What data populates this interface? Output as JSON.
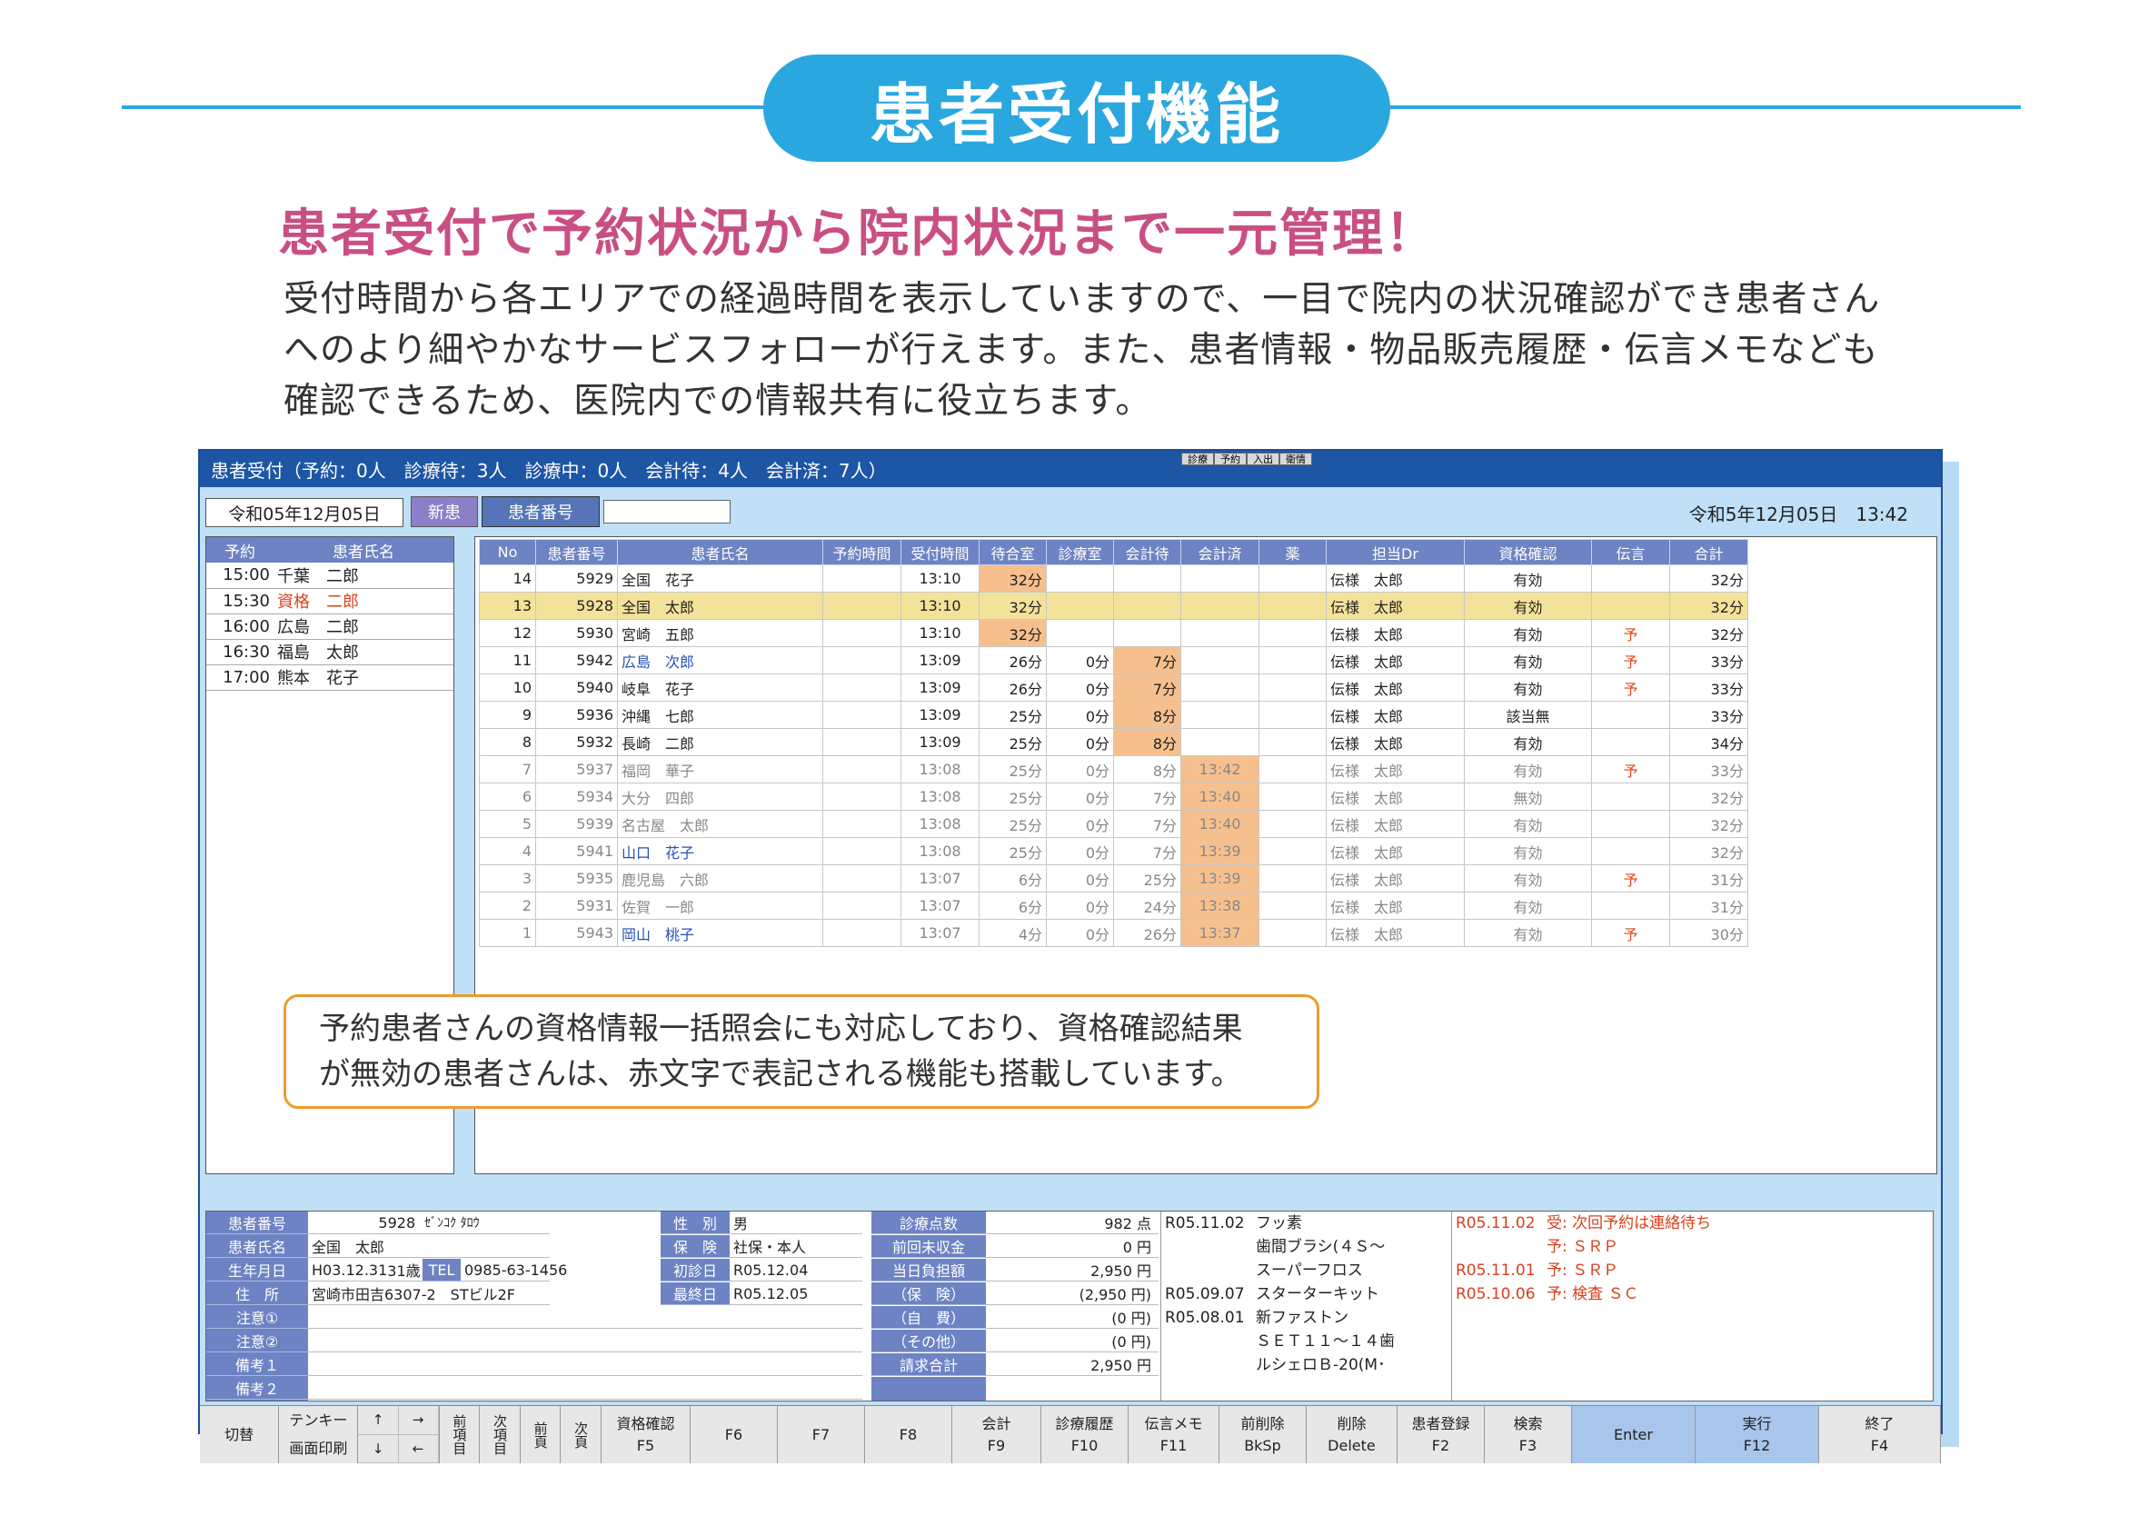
{
  "page": {
    "title": "患者受付機能",
    "headline": "患者受付で予約状況から院内状況まで一元管理！",
    "description": [
      "受付時間から各エリアでの経過時間を表示していますので、一目で院内の状況確認ができ患者さん",
      "へのより細やかなサービスフォローが行えます。また、患者情報・物品販売履歴・伝言メモなども",
      "確認できるため、医院内での情報共有に役立ちます。"
    ],
    "callout": [
      "予約患者さんの資格情報一括照会にも対応しており、資格確認結果",
      "が無効の患者さんは、赤文字で表記される機能も搭載しています。"
    ],
    "accent_color": "#2aa7df",
    "headline_color": "#c94f83"
  },
  "app": {
    "titlebar": "患者受付（予約：0人　診療待：3人　診療中：0人　会計待：4人　会計済：7人）",
    "mini_tabs": [
      "診療",
      "予約",
      "入出",
      "衛情"
    ],
    "date": "令和05年12月05日",
    "new_button": "新患",
    "pid_label": "患者番号",
    "pid_value": "",
    "now": "令和5年12月05日　13:42",
    "left_headers": [
      "予約",
      "患者氏名"
    ],
    "appointments": [
      {
        "time": "15:00",
        "name": "千葉　二郎",
        "red": false
      },
      {
        "time": "15:30",
        "name": "資格　二郎",
        "red": true
      },
      {
        "time": "16:00",
        "name": "広島　二郎",
        "red": false
      },
      {
        "time": "16:30",
        "name": "福島　太郎",
        "red": false
      },
      {
        "time": "17:00",
        "name": "熊本　花子",
        "red": false
      }
    ],
    "grid_headers": [
      "No",
      "患者番号",
      "患者氏名",
      "予約時間",
      "受付時間",
      "待合室",
      "診療室",
      "会計待",
      "会計済",
      "薬",
      "担当Dr",
      "資格確認",
      "伝言",
      "合計"
    ],
    "rows": [
      {
        "no": "14",
        "id": "5929",
        "name": "全国　花子",
        "resv": "",
        "rec": "13:10",
        "wait": "32分",
        "exam": "",
        "pay": "",
        "paid": "",
        "med": "",
        "dr": "伝様　太郎",
        "qual": "有効",
        "msg": "",
        "total": "32分",
        "dim": false,
        "sel": false,
        "blue": false,
        "hl": "wait"
      },
      {
        "no": "13",
        "id": "5928",
        "name": "全国　太郎",
        "resv": "",
        "rec": "13:10",
        "wait": "32分",
        "exam": "",
        "pay": "",
        "paid": "",
        "med": "",
        "dr": "伝様　太郎",
        "qual": "有効",
        "msg": "",
        "total": "32分",
        "dim": false,
        "sel": true,
        "blue": false,
        "hl": "wait"
      },
      {
        "no": "12",
        "id": "5930",
        "name": "宮崎　五郎",
        "resv": "",
        "rec": "13:10",
        "wait": "32分",
        "exam": "",
        "pay": "",
        "paid": "",
        "med": "",
        "dr": "伝様　太郎",
        "qual": "有効",
        "msg": "予",
        "total": "32分",
        "dim": false,
        "sel": false,
        "blue": false,
        "hl": "wait"
      },
      {
        "no": "11",
        "id": "5942",
        "name": "広島　次郎",
        "resv": "",
        "rec": "13:09",
        "wait": "26分",
        "exam": "0分",
        "pay": "7分",
        "paid": "",
        "med": "",
        "dr": "伝様　太郎",
        "qual": "有効",
        "msg": "予",
        "total": "33分",
        "dim": false,
        "sel": false,
        "blue": true,
        "hl": "pay"
      },
      {
        "no": "10",
        "id": "5940",
        "name": "岐阜　花子",
        "resv": "",
        "rec": "13:09",
        "wait": "26分",
        "exam": "0分",
        "pay": "7分",
        "paid": "",
        "med": "",
        "dr": "伝様　太郎",
        "qual": "有効",
        "msg": "予",
        "total": "33分",
        "dim": false,
        "sel": false,
        "blue": false,
        "hl": "pay"
      },
      {
        "no": "9",
        "id": "5936",
        "name": "沖縄　七郎",
        "resv": "",
        "rec": "13:09",
        "wait": "25分",
        "exam": "0分",
        "pay": "8分",
        "paid": "",
        "med": "",
        "dr": "伝様　太郎",
        "qual": "該当無",
        "msg": "",
        "total": "33分",
        "dim": false,
        "sel": false,
        "blue": false,
        "hl": "pay"
      },
      {
        "no": "8",
        "id": "5932",
        "name": "長崎　二郎",
        "resv": "",
        "rec": "13:09",
        "wait": "25分",
        "exam": "0分",
        "pay": "8分",
        "paid": "",
        "med": "",
        "dr": "伝様　太郎",
        "qual": "有効",
        "msg": "",
        "total": "34分",
        "dim": false,
        "sel": false,
        "blue": false,
        "hl": "pay"
      },
      {
        "no": "7",
        "id": "5937",
        "name": "福岡　華子",
        "resv": "",
        "rec": "13:08",
        "wait": "25分",
        "exam": "0分",
        "pay": "8分",
        "paid": "13:42",
        "med": "",
        "dr": "伝様　太郎",
        "qual": "有効",
        "msg": "予",
        "total": "33分",
        "dim": true,
        "sel": false,
        "blue": false,
        "hl": "paid"
      },
      {
        "no": "6",
        "id": "5934",
        "name": "大分　四郎",
        "resv": "",
        "rec": "13:08",
        "wait": "25分",
        "exam": "0分",
        "pay": "7分",
        "paid": "13:40",
        "med": "",
        "dr": "伝様　太郎",
        "qual": "無効",
        "msg": "",
        "total": "32分",
        "dim": true,
        "sel": false,
        "blue": false,
        "hl": "paid"
      },
      {
        "no": "5",
        "id": "5939",
        "name": "名古屋　太郎",
        "resv": "",
        "rec": "13:08",
        "wait": "25分",
        "exam": "0分",
        "pay": "7分",
        "paid": "13:40",
        "med": "",
        "dr": "伝様　太郎",
        "qual": "有効",
        "msg": "",
        "total": "32分",
        "dim": true,
        "sel": false,
        "blue": false,
        "hl": "paid"
      },
      {
        "no": "4",
        "id": "5941",
        "name": "山口　花子",
        "resv": "",
        "rec": "13:08",
        "wait": "25分",
        "exam": "0分",
        "pay": "7分",
        "paid": "13:39",
        "med": "",
        "dr": "伝様　太郎",
        "qual": "有効",
        "msg": "",
        "total": "32分",
        "dim": true,
        "sel": false,
        "blue": true,
        "hl": "paid"
      },
      {
        "no": "3",
        "id": "5935",
        "name": "鹿児島　六郎",
        "resv": "",
        "rec": "13:07",
        "wait": "6分",
        "exam": "0分",
        "pay": "25分",
        "paid": "13:39",
        "med": "",
        "dr": "伝様　太郎",
        "qual": "有効",
        "msg": "予",
        "total": "31分",
        "dim": true,
        "sel": false,
        "blue": false,
        "hl": "paid"
      },
      {
        "no": "2",
        "id": "5931",
        "name": "佐賀　一郎",
        "resv": "",
        "rec": "13:07",
        "wait": "6分",
        "exam": "0分",
        "pay": "24分",
        "paid": "13:38",
        "med": "",
        "dr": "伝様　太郎",
        "qual": "有効",
        "msg": "",
        "total": "31分",
        "dim": true,
        "sel": false,
        "blue": false,
        "hl": "paid"
      },
      {
        "no": "1",
        "id": "5943",
        "name": "岡山　桃子",
        "resv": "",
        "rec": "13:07",
        "wait": "4分",
        "exam": "0分",
        "pay": "26分",
        "paid": "13:37",
        "med": "",
        "dr": "伝様　太郎",
        "qual": "有効",
        "msg": "予",
        "total": "30分",
        "dim": true,
        "sel": false,
        "blue": true,
        "hl": "paid"
      }
    ],
    "patient": {
      "id_label": "患者番号",
      "id": "5928",
      "kana": "ｾﾞﾝｺｸ ﾀﾛｳ",
      "name_label": "患者氏名",
      "name": "全国　太郎",
      "dob_label": "生年月日",
      "dob": "H03.12.31",
      "age": "31歳",
      "tel_label": "TEL",
      "tel": "0985-63-1456",
      "addr_label": "住　所",
      "addr": "宮崎市田吉6307-2　STビル2F",
      "note1_label": "注意①",
      "note2_label": "注意②",
      "memo1_label": "備考１",
      "memo2_label": "備考２",
      "sex_label": "性　別",
      "sex": "男",
      "ins_label": "保　険",
      "ins": "社保・本人",
      "first_label": "初診日",
      "first": "R05.12.04",
      "last_label": "最終日",
      "last": "R05.12.05"
    },
    "billing": [
      {
        "label": "診療点数",
        "value": "982 点"
      },
      {
        "label": "前回未収金",
        "value": "0 円"
      },
      {
        "label": "当日負担額",
        "value": "2,950 円"
      },
      {
        "label": "（保　険）",
        "value": "(2,950 円)"
      },
      {
        "label": "（自　費）",
        "value": "(0 円)"
      },
      {
        "label": "（その他）",
        "value": "(0 円)"
      },
      {
        "label": "請求合計",
        "value": "2,950 円"
      }
    ],
    "history": [
      {
        "date": "R05.11.02",
        "item": "フッ素"
      },
      {
        "date": "",
        "item": "歯間ブラシ(４Ｓ～"
      },
      {
        "date": "",
        "item": "スーパーフロス"
      },
      {
        "date": "R05.09.07",
        "item": "スターターキット"
      },
      {
        "date": "R05.08.01",
        "item": "新ファストン"
      },
      {
        "date": "",
        "item": "ＳＥＴ１１～１４歯"
      },
      {
        "date": "",
        "item": "ルシェロＢ-20(M･"
      }
    ],
    "memos": [
      {
        "date": "R05.11.02",
        "text": "受: 次回予約は連絡待ち"
      },
      {
        "date": "",
        "text": "予: ＳＲＰ"
      },
      {
        "date": "R05.11.01",
        "text": "予: ＳＲＰ"
      },
      {
        "date": "R05.10.06",
        "text": "予: 検査 ＳＣ"
      }
    ],
    "fkeys": {
      "kirikae": "切替",
      "tenkey": "テンキー",
      "print": "画面印刷",
      "up": "↑",
      "right": "→",
      "down": "↓",
      "left": "←",
      "prev_item": "前項目",
      "next_item": "次項目",
      "prev_page": "前頁",
      "next_page": "次頁",
      "keys": [
        {
          "top": "資格確認",
          "bottom": "F5"
        },
        {
          "top": "",
          "bottom": "F6"
        },
        {
          "top": "",
          "bottom": "F7"
        },
        {
          "top": "",
          "bottom": "F8"
        },
        {
          "top": "会計",
          "bottom": "F9"
        },
        {
          "top": "診療履歴",
          "bottom": "F10"
        },
        {
          "top": "伝言メモ",
          "bottom": "F11"
        },
        {
          "top": "前削除",
          "bottom": "BkSp"
        },
        {
          "top": "削除",
          "bottom": "Delete"
        },
        {
          "top": "患者登録",
          "bottom": "F2"
        },
        {
          "top": "検索",
          "bottom": "F3"
        },
        {
          "top": "Enter",
          "bottom": ""
        },
        {
          "top": "実行",
          "bottom": "F12"
        },
        {
          "top": "終了",
          "bottom": "F4"
        }
      ]
    }
  }
}
